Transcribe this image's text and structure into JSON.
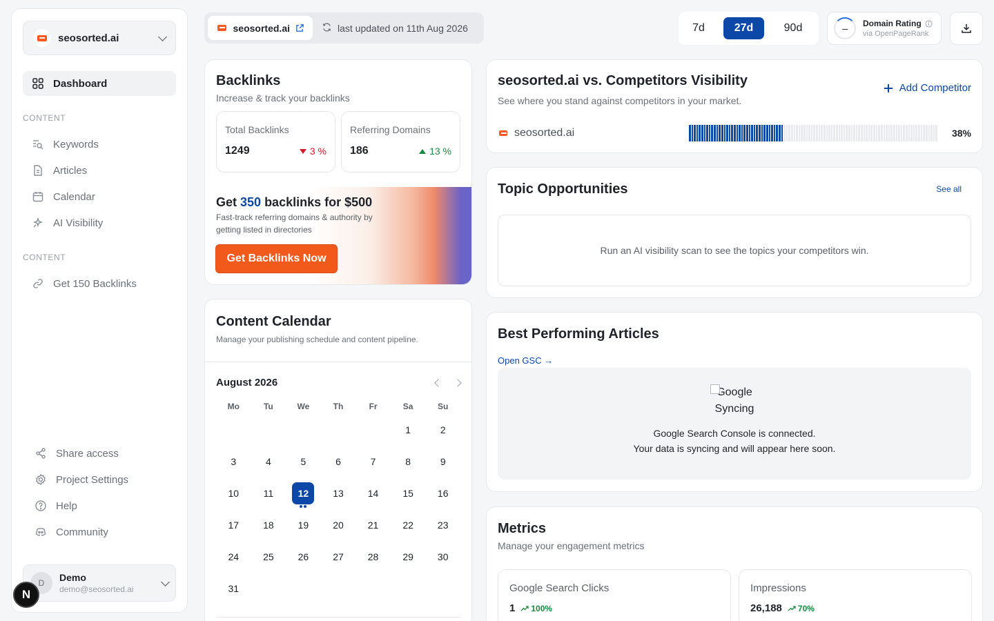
{
  "sidebar": {
    "workspace": "seosorted.ai",
    "dashboard": "Dashboard",
    "section1": "CONTENT",
    "items": [
      "Keywords",
      "Articles",
      "Calendar",
      "AI Visibility"
    ],
    "section2": "CONTENT",
    "items2": [
      "Get 150 Backlinks"
    ],
    "bottom": [
      "Share access",
      "Project Settings",
      "Help",
      "Community"
    ],
    "user": {
      "initial": "D",
      "name": "Demo",
      "email": "demo@seosorted.ai"
    },
    "dev_badge": "N"
  },
  "topbar": {
    "site": "seosorted.ai",
    "updated": "last updated on 11th Aug 2026",
    "ranges": [
      "7d",
      "27d",
      "90d"
    ],
    "active_range": "27d",
    "domain_rating": {
      "value": "–",
      "title": "Domain Rating",
      "source": "via OpenPageRank"
    }
  },
  "backlinks": {
    "title": "Backlinks",
    "subtitle": "Increase & track your backlinks",
    "total": {
      "label": "Total Backlinks",
      "value": "1249",
      "change": "3 %",
      "direction": "down"
    },
    "referring": {
      "label": "Referring Domains",
      "value": "186",
      "change": "13 %",
      "direction": "up"
    },
    "promo": {
      "title_prefix": "Get ",
      "title_number": "350",
      "title_suffix": " backlinks for $500",
      "desc": "Fast-track referring domains & authority by getting listed in directories",
      "cta": "Get Backlinks Now"
    }
  },
  "calendar": {
    "title": "Content Calendar",
    "subtitle": "Manage your publishing schedule and content pipeline.",
    "month": "August 2026",
    "weekdays": [
      "Mo",
      "Tu",
      "We",
      "Th",
      "Fr",
      "Sa",
      "Su"
    ],
    "first_weekday_index": 5,
    "days": 31,
    "today": 12
  },
  "visibility": {
    "title": "seosorted.ai vs. Competitors Visibility",
    "subtitle": "See where you stand against competitors in your market.",
    "add_competitor": "Add Competitor",
    "row": {
      "name": "seosorted.ai",
      "percent": "38%",
      "fraction": 0.38
    },
    "accent": "#0b48a8"
  },
  "topics": {
    "title": "Topic Opportunities",
    "see_all": "See all",
    "empty": "Run an AI visibility scan to see the topics your competitors win."
  },
  "best_articles": {
    "title": "Best Performing Articles",
    "link": "Open GSC →",
    "image_alt": "Google Syncing",
    "line1": "Google Search Console is connected.",
    "line2": "Your data is syncing and will appear here soon."
  },
  "metrics": {
    "title": "Metrics",
    "subtitle": "Manage your engagement metrics",
    "clicks": {
      "label": "Google Search Clicks",
      "value": "1",
      "change": "100%"
    },
    "impressions": {
      "label": "Impressions",
      "value": "26,188",
      "change": "70%"
    }
  }
}
